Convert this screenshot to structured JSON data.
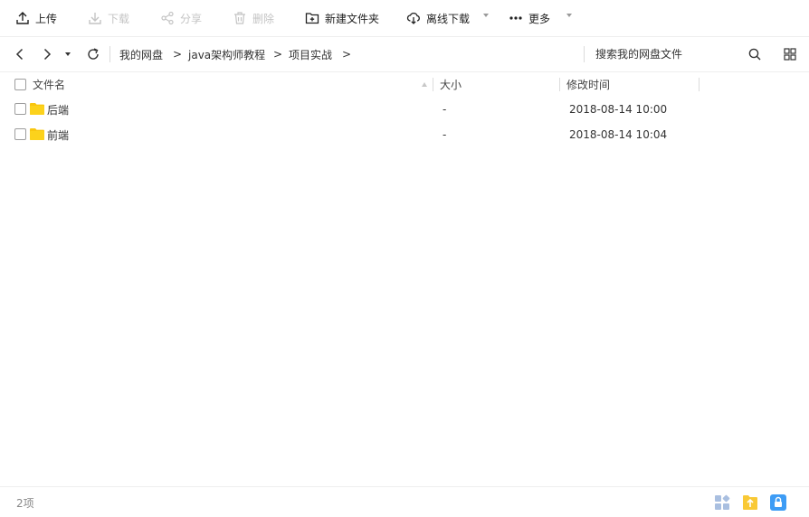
{
  "toolbar": {
    "upload_label": "上传",
    "download_label": "下载",
    "share_label": "分享",
    "delete_label": "删除",
    "new_folder_label": "新建文件夹",
    "offline_download_label": "离线下载",
    "more_label": "更多"
  },
  "nav": {
    "breadcrumbs": [
      "我的网盘",
      "java架构师教程",
      "项目实战"
    ],
    "separator": ">",
    "search_placeholder": "搜索我的网盘文件"
  },
  "table": {
    "columns": {
      "name": "文件名",
      "size": "大小",
      "modified": "修改时间"
    },
    "rows": [
      {
        "name": "后端",
        "size": "-",
        "modified": "2018-08-14 10:00",
        "type": "folder"
      },
      {
        "name": "前端",
        "size": "-",
        "modified": "2018-08-14 10:04",
        "type": "folder"
      }
    ]
  },
  "status": {
    "item_count": "2项"
  },
  "colors": {
    "folder": "#f9c60f",
    "accent_blue": "#3d9cf5",
    "accent_yellow": "#f9c935",
    "grid_icon": "#a9bfe0"
  }
}
